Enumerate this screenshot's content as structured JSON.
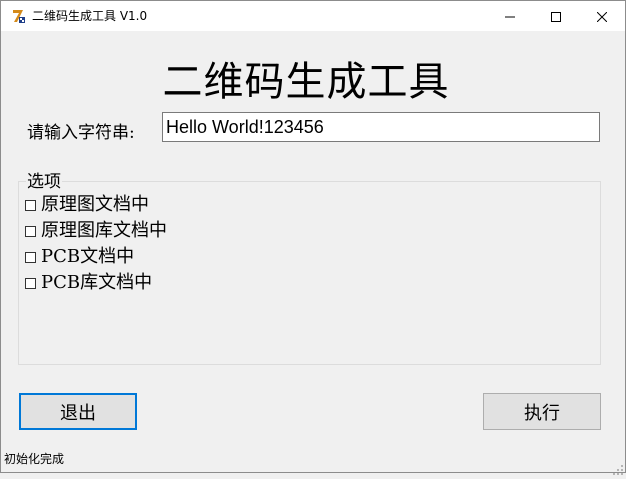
{
  "window": {
    "title": "二维码生成工具 V1.0",
    "app_icon": "qr-tool-icon",
    "controls": {
      "minimize_icon": "minimize-icon",
      "maximize_icon": "maximize-icon",
      "close_icon": "close-icon"
    }
  },
  "main": {
    "heading": "二维码生成工具",
    "input_label": "请输入字符串:",
    "input_value": "Hello World!123456"
  },
  "options": {
    "legend": "选项",
    "items": [
      {
        "label": "原理图文档中",
        "checked": false
      },
      {
        "label": "原理图库文档中",
        "checked": false
      },
      {
        "label": "PCB文档中",
        "checked": false
      },
      {
        "label": "PCB库文档中",
        "checked": false
      }
    ]
  },
  "buttons": {
    "exit_label": "退出",
    "run_label": "执行"
  },
  "status": {
    "text": "初始化完成"
  },
  "colors": {
    "focus_border": "#0078d7",
    "window_bg": "#f0f0f0",
    "button_bg": "#e1e1e1"
  }
}
